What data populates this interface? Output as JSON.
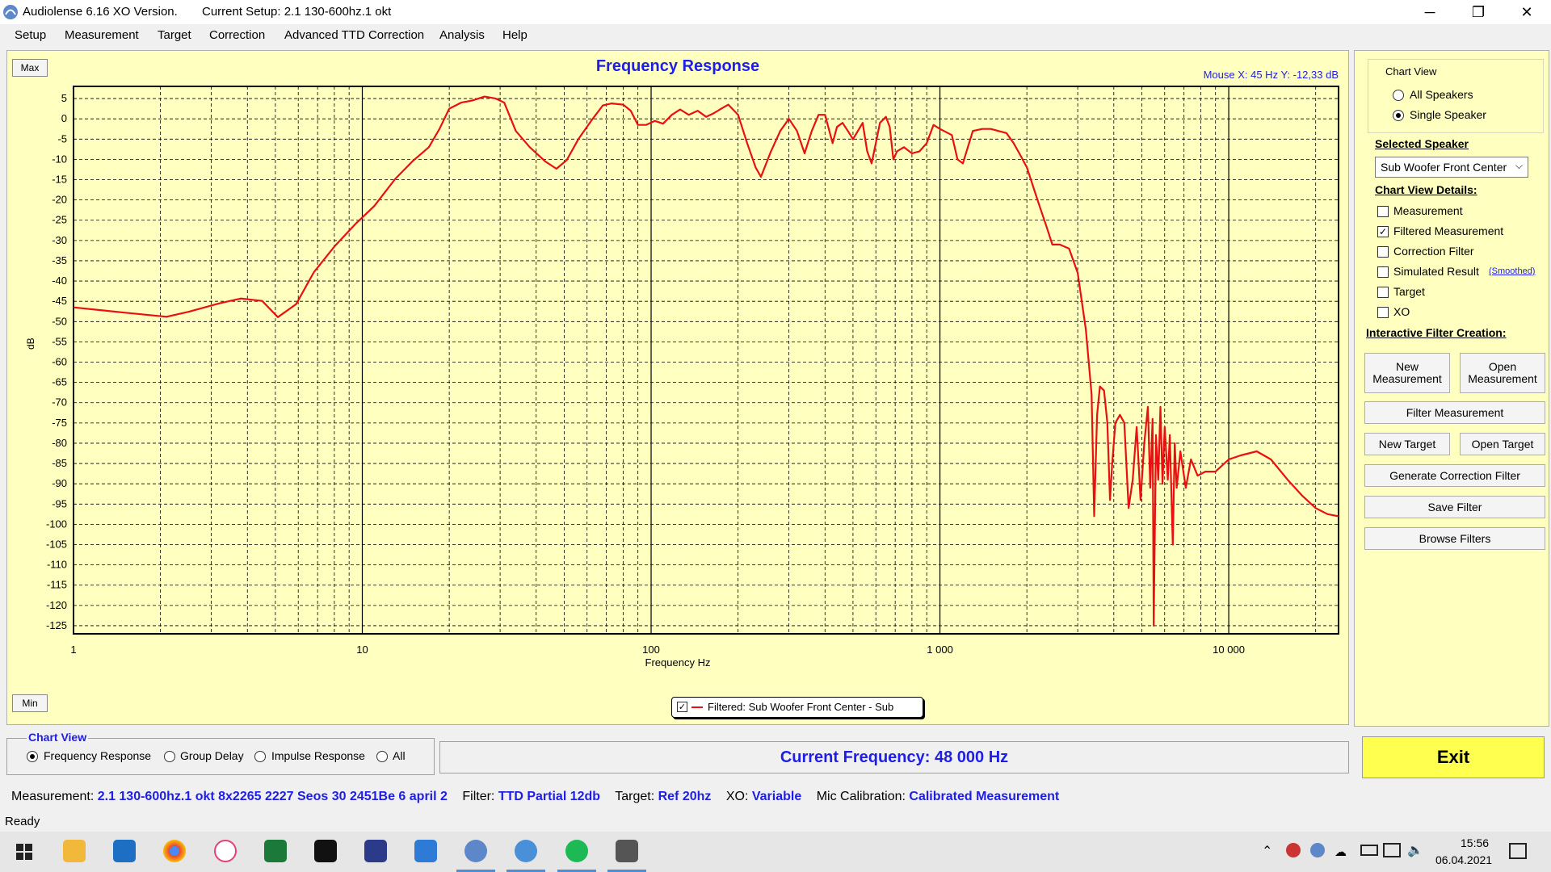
{
  "window": {
    "app_title": "Audiolense 6.16 XO Version.",
    "setup_title": "Current Setup: 2.1 130-600hz.1 okt",
    "minimize": "─",
    "maximize": "❐",
    "close": "✕"
  },
  "menu": [
    "Setup",
    "Measurement",
    "Target",
    "Correction",
    "Advanced TTD Correction",
    "Analysis",
    "Help"
  ],
  "chart": {
    "max_label": "Max",
    "min_label": "Min",
    "title": "Frequency Response",
    "mouse_readout": "Mouse X: 45 Hz   Y: -12,33 dB",
    "legend_text": "Filtered: Sub Woofer Front Center - Sub",
    "line_color": "#e81010"
  },
  "chart_data": {
    "type": "line",
    "title": "Frequency Response",
    "xlabel": "Frequency Hz",
    "ylabel": "dB",
    "x_scale": "log",
    "xlim": [
      1,
      24000
    ],
    "ylim": [
      -127,
      8
    ],
    "x_tick_labels": [
      "1",
      "10",
      "100",
      "1 000",
      "10 000"
    ],
    "x_tick_values": [
      1,
      10,
      100,
      1000,
      10000
    ],
    "y_ticks": [
      5,
      0,
      -5,
      -10,
      -15,
      -20,
      -25,
      -30,
      -35,
      -40,
      -45,
      -50,
      -55,
      -60,
      -65,
      -70,
      -75,
      -80,
      -85,
      -90,
      -95,
      -100,
      -105,
      -110,
      -115,
      -120,
      -125
    ],
    "grid": true,
    "legend_placement": "bottom-center",
    "series": [
      {
        "name": "Filtered: Sub Woofer Front Center - Sub",
        "color": "#e81010",
        "points": [
          [
            1,
            -46.5
          ],
          [
            1.5,
            -47.8
          ],
          [
            2.1,
            -48.8
          ],
          [
            2.5,
            -47.6
          ],
          [
            3.2,
            -45.5
          ],
          [
            3.8,
            -44.3
          ],
          [
            4.5,
            -44.9
          ],
          [
            5.1,
            -48.9
          ],
          [
            5.9,
            -45.7
          ],
          [
            6.8,
            -37.8
          ],
          [
            8,
            -31.5
          ],
          [
            9.5,
            -25.8
          ],
          [
            11,
            -21.5
          ],
          [
            13,
            -14.8
          ],
          [
            15,
            -10.3
          ],
          [
            17,
            -7
          ],
          [
            18.5,
            -2.5
          ],
          [
            20,
            2.5
          ],
          [
            22,
            4
          ],
          [
            24,
            4.5
          ],
          [
            26.5,
            5.5
          ],
          [
            29,
            5
          ],
          [
            31,
            4
          ],
          [
            34,
            -3
          ],
          [
            38,
            -7
          ],
          [
            43,
            -10.5
          ],
          [
            47,
            -12.3
          ],
          [
            51,
            -10.2
          ],
          [
            56,
            -5
          ],
          [
            62,
            -0.5
          ],
          [
            68,
            3.3
          ],
          [
            73,
            3.8
          ],
          [
            80,
            3.5
          ],
          [
            85,
            2
          ],
          [
            90,
            -1.5
          ],
          [
            96,
            -1.5
          ],
          [
            103,
            -0.5
          ],
          [
            110,
            -1.2
          ],
          [
            118,
            1
          ],
          [
            126,
            2.3
          ],
          [
            135,
            1
          ],
          [
            145,
            2
          ],
          [
            155,
            0.5
          ],
          [
            165,
            1.4
          ],
          [
            175,
            2.5
          ],
          [
            185,
            3.5
          ],
          [
            200,
            1
          ],
          [
            215,
            -6
          ],
          [
            230,
            -12
          ],
          [
            240,
            -14.3
          ],
          [
            260,
            -8
          ],
          [
            280,
            -3
          ],
          [
            300,
            0
          ],
          [
            320,
            -3
          ],
          [
            340,
            -8.5
          ],
          [
            360,
            -3
          ],
          [
            380,
            1
          ],
          [
            400,
            1
          ],
          [
            425,
            -6
          ],
          [
            440,
            -2
          ],
          [
            460,
            -1
          ],
          [
            480,
            -3
          ],
          [
            500,
            -5
          ],
          [
            520,
            -3
          ],
          [
            540,
            -1
          ],
          [
            560,
            -8
          ],
          [
            580,
            -11
          ],
          [
            600,
            -6
          ],
          [
            620,
            -1
          ],
          [
            650,
            0.5
          ],
          [
            670,
            -2
          ],
          [
            690,
            -10
          ],
          [
            710,
            -8
          ],
          [
            750,
            -7
          ],
          [
            800,
            -8.5
          ],
          [
            850,
            -8
          ],
          [
            900,
            -6
          ],
          [
            950,
            -1.5
          ],
          [
            1000,
            -2.5
          ],
          [
            1100,
            -4
          ],
          [
            1150,
            -10
          ],
          [
            1200,
            -11
          ],
          [
            1300,
            -3
          ],
          [
            1400,
            -2.5
          ],
          [
            1500,
            -2.5
          ],
          [
            1700,
            -3.5
          ],
          [
            1800,
            -6
          ],
          [
            1900,
            -9
          ],
          [
            2000,
            -12
          ],
          [
            2200,
            -21
          ],
          [
            2350,
            -27
          ],
          [
            2450,
            -31
          ],
          [
            2600,
            -31
          ],
          [
            2800,
            -32
          ],
          [
            3000,
            -38
          ],
          [
            3200,
            -52
          ],
          [
            3350,
            -68
          ],
          [
            3420,
            -98
          ],
          [
            3500,
            -73
          ],
          [
            3580,
            -66
          ],
          [
            3700,
            -67
          ],
          [
            3800,
            -75
          ],
          [
            3880,
            -94
          ],
          [
            3950,
            -85
          ],
          [
            4050,
            -75
          ],
          [
            4200,
            -73
          ],
          [
            4350,
            -75
          ],
          [
            4500,
            -96
          ],
          [
            4650,
            -89
          ],
          [
            4800,
            -76
          ],
          [
            4950,
            -94
          ],
          [
            5100,
            -80
          ],
          [
            5250,
            -71
          ],
          [
            5350,
            -91
          ],
          [
            5450,
            -74
          ],
          [
            5500,
            -125
          ],
          [
            5600,
            -78
          ],
          [
            5700,
            -89
          ],
          [
            5800,
            -71
          ],
          [
            5900,
            -90
          ],
          [
            6000,
            -76
          ],
          [
            6150,
            -89
          ],
          [
            6250,
            -78
          ],
          [
            6400,
            -105
          ],
          [
            6500,
            -80
          ],
          [
            6600,
            -91
          ],
          [
            6800,
            -82
          ],
          [
            7100,
            -91
          ],
          [
            7400,
            -84
          ],
          [
            7800,
            -88
          ],
          [
            8300,
            -87
          ],
          [
            9000,
            -87
          ],
          [
            10000,
            -84
          ],
          [
            11000,
            -83
          ],
          [
            12500,
            -82
          ],
          [
            14000,
            -84
          ],
          [
            16000,
            -89
          ],
          [
            18000,
            -93
          ],
          [
            20000,
            -96
          ],
          [
            22000,
            -97.5
          ],
          [
            24000,
            -98
          ]
        ]
      }
    ]
  },
  "right_panel": {
    "chart_view_title": "Chart View",
    "all_speakers": "All Speakers",
    "single_speaker": "Single Speaker",
    "selected_speaker_head": "Selected Speaker",
    "selected_speaker_value": "Sub Woofer Front Center",
    "details_head": "Chart View Details:",
    "details": [
      {
        "label": "Measurement",
        "checked": false
      },
      {
        "label": "Filtered Measurement",
        "checked": true
      },
      {
        "label": "Correction Filter",
        "checked": false
      },
      {
        "label": "Simulated Result",
        "checked": false
      },
      {
        "label": "Target",
        "checked": false
      },
      {
        "label": "XO",
        "checked": false
      }
    ],
    "smoothed_link": "(Smoothed)",
    "interactive_head": "Interactive Filter Creation:",
    "buttons": {
      "new_measurement": "New Measurement",
      "open_measurement": "Open Measurement",
      "filter_measurement": "Filter Measurement",
      "new_target": "New Target",
      "open_target": "Open Target",
      "generate_correction": "Generate Correction Filter",
      "save_filter": "Save Filter",
      "browse_filters": "Browse Filters"
    }
  },
  "bottom": {
    "chart_view_title": "Chart View",
    "view_options": [
      {
        "label": "Frequency Response",
        "selected": true
      },
      {
        "label": "Group Delay",
        "selected": false
      },
      {
        "label": "Impulse Response",
        "selected": false
      },
      {
        "label": "All",
        "selected": false
      }
    ],
    "current_frequency": "Current Frequency: 48 000 Hz",
    "exit": "Exit"
  },
  "info": {
    "measurement_label": "Measurement:",
    "measurement_value": "2.1 130-600hz.1 okt 8x2265 2227 Seos 30 2451Be  6 april 2",
    "filter_label": "Filter:",
    "filter_value": "TTD Partial 12db",
    "target_label": "Target:",
    "target_value": "Ref 20hz",
    "xo_label": "XO:",
    "xo_value": "Variable",
    "mic_label": "Mic Calibration:",
    "mic_value": "Calibrated Measurement",
    "status": "Ready"
  },
  "taskbar": {
    "time": "15:56",
    "date": "06.04.2021",
    "apps": [
      "windows-start",
      "file-explorer",
      "mail",
      "chrome",
      "itunes",
      "excel-green",
      "tidal",
      "rew",
      "word-blue",
      "audiolense",
      "media-player",
      "spotify",
      "monitor-gauge"
    ]
  }
}
